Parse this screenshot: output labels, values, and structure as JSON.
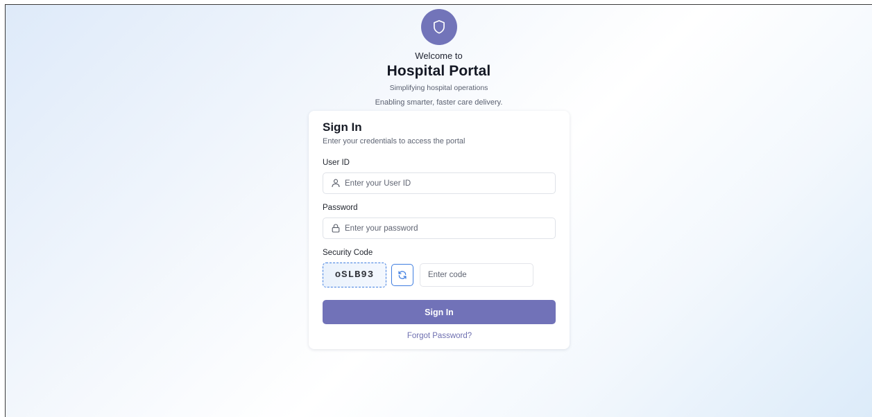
{
  "header": {
    "welcome": "Welcome to",
    "title": "Hospital Portal",
    "tagline_primary": "Simplifying hospital operations",
    "tagline_secondary": "Enabling smarter, faster care delivery.",
    "logo_icon": "shield-icon"
  },
  "form": {
    "title": "Sign In",
    "subtitle": "Enter your credentials to access the portal",
    "user_id": {
      "label": "User ID",
      "placeholder": "Enter your User ID",
      "value": "",
      "icon": "user-icon"
    },
    "password": {
      "label": "Password",
      "placeholder": "Enter your password",
      "value": "",
      "icon": "lock-icon"
    },
    "security_code": {
      "label": "Security Code",
      "captcha": "oSLB93",
      "refresh_icon": "refresh-icon",
      "placeholder": "Enter code",
      "value": ""
    },
    "submit_label": "Sign In",
    "forgot_label": "Forgot Password?"
  },
  "colors": {
    "brand": "#7274b9",
    "accent_blue": "#3e7de0",
    "link": "#6e6fb0"
  }
}
